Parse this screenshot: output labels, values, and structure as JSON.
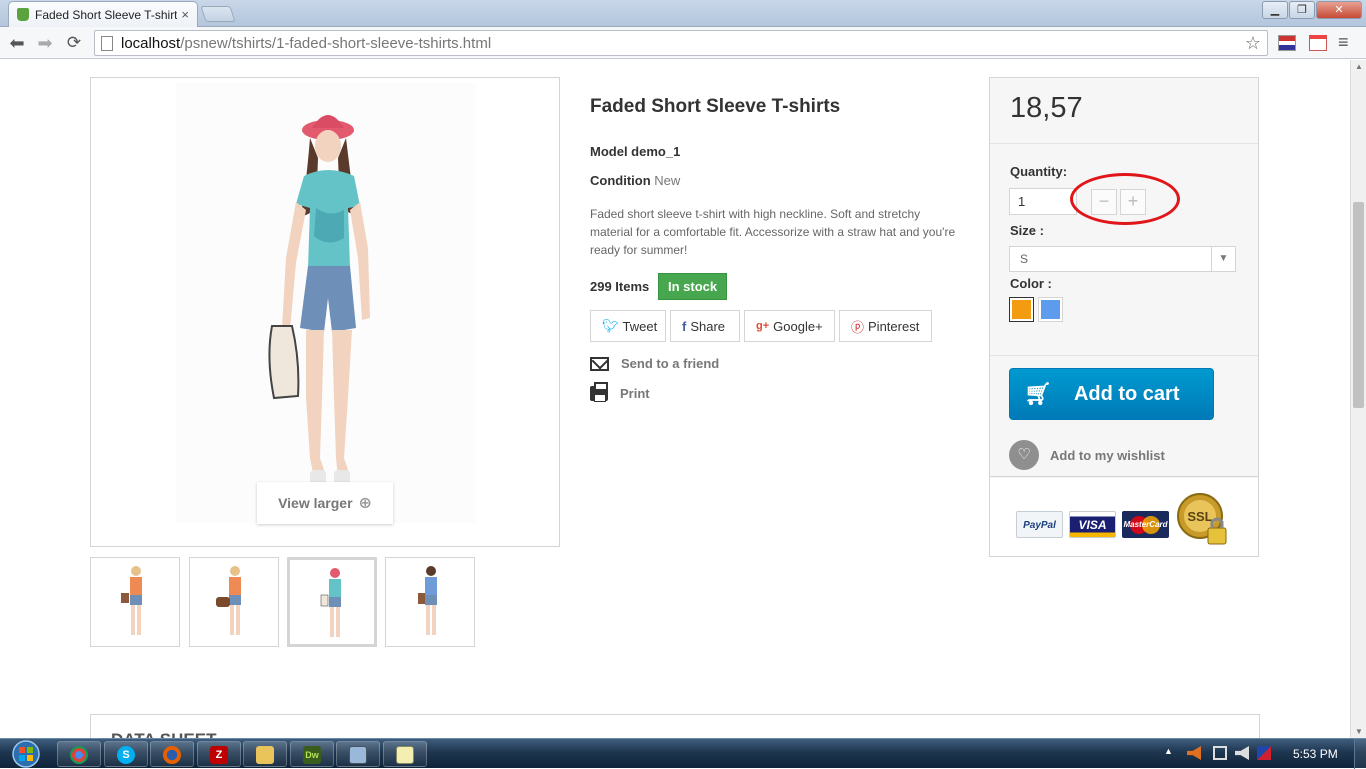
{
  "browser": {
    "tab_title": "Faded Short Sleeve T-shirt",
    "tab_close": "×",
    "url_host": "localhost",
    "url_path": "/psnew/tshirts/1-faded-short-sleeve-tshirts.html"
  },
  "product": {
    "title": "Faded Short Sleeve T-shirts",
    "model": "Model demo_1",
    "condition_label": "Condition",
    "condition_value": "New",
    "description": "Faded short sleeve t-shirt with high neckline. Soft and stretchy material for a comfortable fit. Accessorize with a straw hat and you're ready for summer!",
    "items_count": "299 Items",
    "stock_status": "In stock",
    "view_larger": "View larger"
  },
  "social": {
    "tweet": "Tweet",
    "share": "Share",
    "google": "Google+",
    "pinterest": "Pinterest"
  },
  "links": {
    "send_friend": "Send to a friend",
    "print": "Print"
  },
  "buy_box": {
    "price": "18,57",
    "quantity_label": "Quantity:",
    "quantity_value": "1",
    "qty_minus": "−",
    "qty_plus": "+",
    "size_label": "Size :",
    "size_selected": "S",
    "color_label": "Color :",
    "colors": [
      "#f39c11",
      "#5d9cec"
    ],
    "add_to_cart": "Add to cart",
    "wishlist": "Add to my wishlist",
    "payment": {
      "paypal": "PayPal",
      "visa": "VISA",
      "mastercard": "MasterCard",
      "ssl": "SSL"
    }
  },
  "data_sheet": {
    "title": "DATA SHEET"
  },
  "taskbar": {
    "clock": "5:53 PM"
  }
}
